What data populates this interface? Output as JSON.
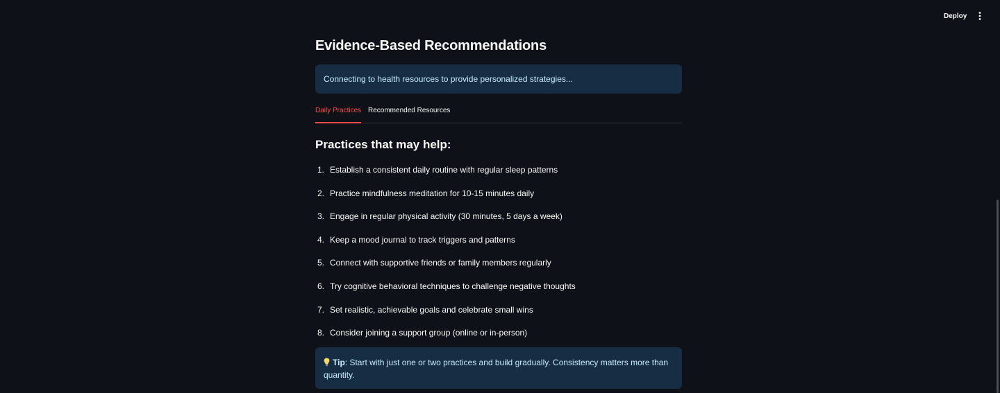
{
  "header": {
    "deploy_label": "Deploy",
    "menu_icon": "vertical-ellipsis-icon"
  },
  "main": {
    "title": "Evidence-Based Recommendations",
    "info_message": "Connecting to health resources to provide personalized strategies...",
    "tabs": [
      {
        "label": "Daily Practices",
        "active": true
      },
      {
        "label": "Recommended Resources",
        "active": false
      }
    ],
    "section_heading": "Practices that may help:",
    "practices": [
      {
        "num": "1.",
        "text": "Establish a consistent daily routine with regular sleep patterns"
      },
      {
        "num": "2.",
        "text": "Practice mindfulness meditation for 10-15 minutes daily"
      },
      {
        "num": "3.",
        "text": "Engage in regular physical activity (30 minutes, 5 days a week)"
      },
      {
        "num": "4.",
        "text": "Keep a mood journal to track triggers and patterns"
      },
      {
        "num": "5.",
        "text": "Connect with supportive friends or family members regularly"
      },
      {
        "num": "6.",
        "text": "Try cognitive behavioral techniques to challenge negative thoughts"
      },
      {
        "num": "7.",
        "text": "Set realistic, achievable goals and celebrate small wins"
      },
      {
        "num": "8.",
        "text": "Consider joining a support group (online or in-person)"
      }
    ],
    "tip": {
      "icon": "lightbulb-icon",
      "label": "Tip",
      "text": ": Start with just one or two practices and build gradually. Consistency matters more than quantity."
    }
  },
  "colors": {
    "background": "#0e1117",
    "accent": "#ff4b4b",
    "info_bg": "#172d43",
    "info_text": "#c7ebff"
  }
}
